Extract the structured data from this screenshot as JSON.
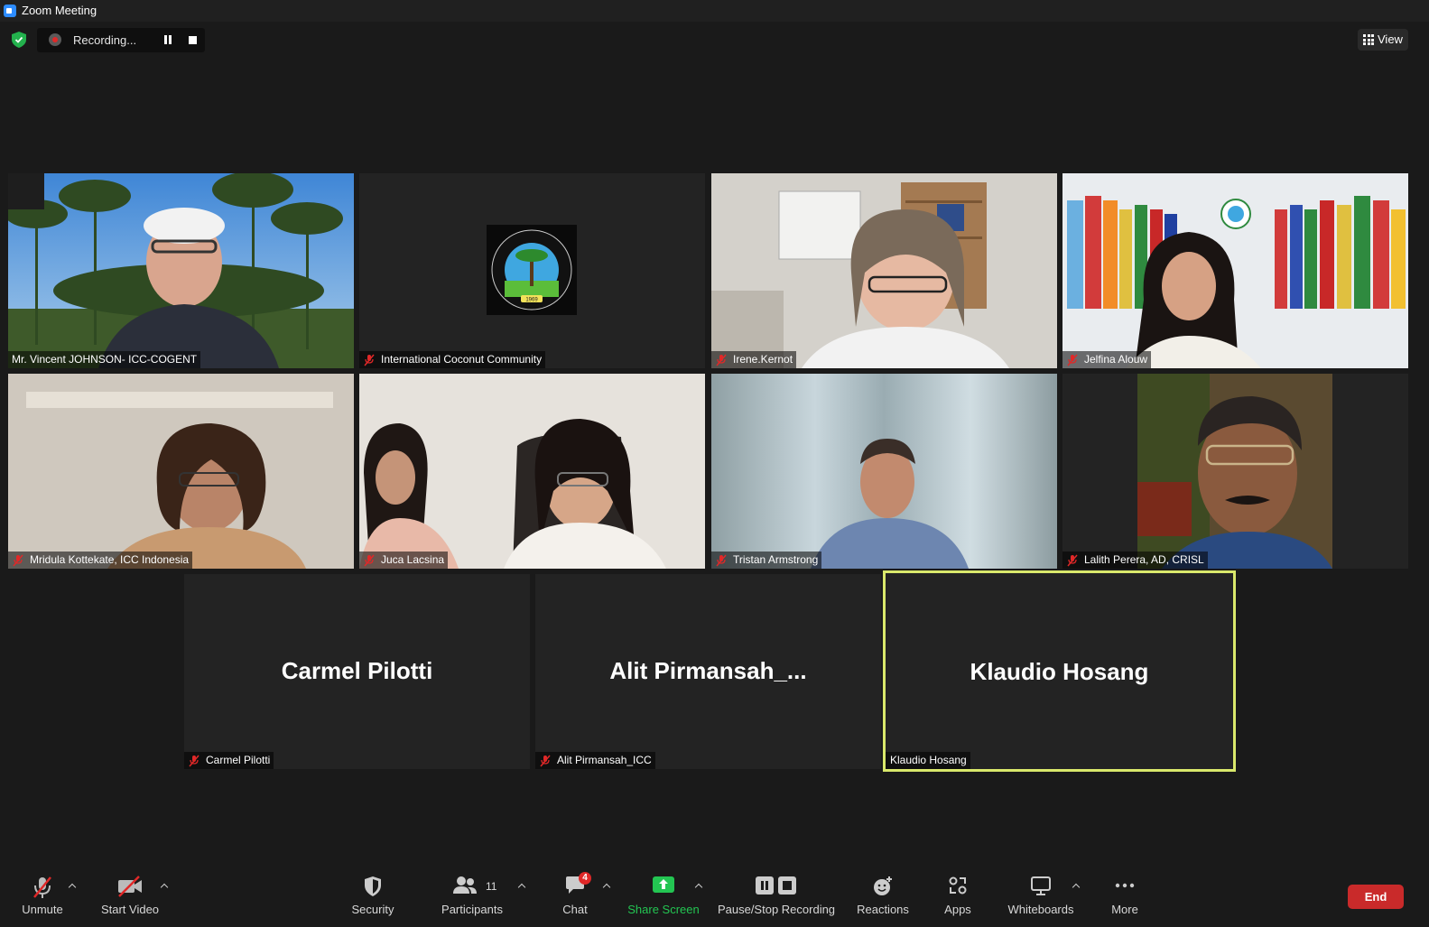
{
  "window": {
    "title": "Zoom Meeting"
  },
  "recording": {
    "status": "Recording..."
  },
  "view": {
    "label": "View"
  },
  "tiles": [
    {
      "name": "Mr. Vincent JOHNSON- ICC-COGENT",
      "muted": false
    },
    {
      "name": "International Coconut Community",
      "muted": true,
      "logo_year": "1969"
    },
    {
      "name": "Irene.Kernot",
      "muted": true
    },
    {
      "name": "Jelfina Alouw",
      "muted": true
    },
    {
      "name": "Mridula Kottekate, ICC Indonesia",
      "muted": true
    },
    {
      "name": "Juca Lacsina",
      "muted": true
    },
    {
      "name": "Tristan Armstrong",
      "muted": true
    },
    {
      "name": "Lalith Perera, AD, CRISL",
      "muted": true
    },
    {
      "name": "Carmel Pilotti",
      "display": "Carmel Pilotti",
      "muted": true
    },
    {
      "name": "Alit Pirmansah_ICC",
      "display": "Alit  Pirmansah_...",
      "muted": true
    },
    {
      "name": "Klaudio Hosang",
      "display": "Klaudio Hosang",
      "muted": false,
      "active_speaker": true
    }
  ],
  "toolbar": {
    "unmute": "Unmute",
    "start_video": "Start Video",
    "security": "Security",
    "participants": "Participants",
    "participants_count": "11",
    "chat": "Chat",
    "chat_badge": "4",
    "share_screen": "Share Screen",
    "pause_stop_recording": "Pause/Stop Recording",
    "reactions": "Reactions",
    "apps": "Apps",
    "whiteboards": "Whiteboards",
    "more": "More",
    "end": "End"
  },
  "colors": {
    "background": "#1a1a1a",
    "active_border": "#d9e86b",
    "share_green": "#23c552",
    "end_red": "#c92a2a",
    "muted_red": "#e02828"
  }
}
